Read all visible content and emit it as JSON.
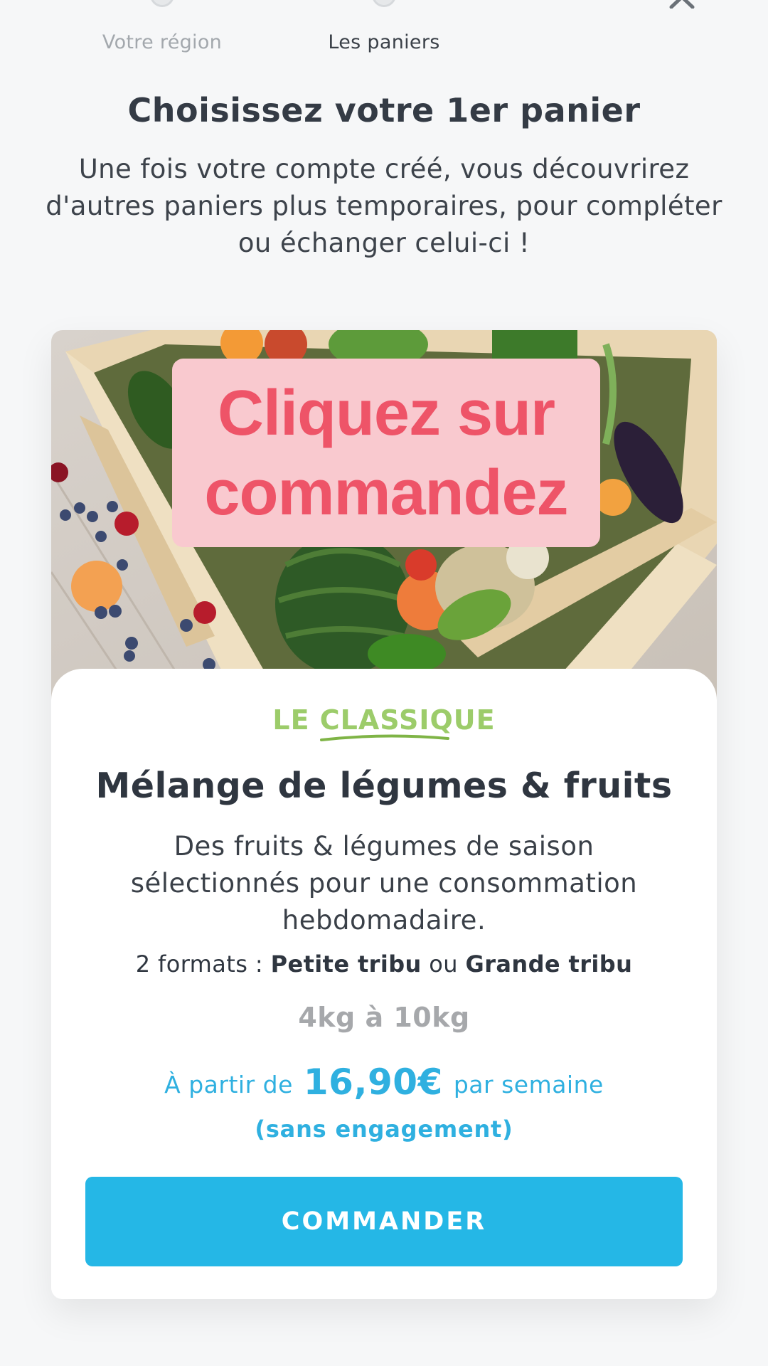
{
  "stepper": {
    "steps": [
      {
        "label": "Votre région",
        "state": "done"
      },
      {
        "label": "Les paniers",
        "state": "current"
      }
    ]
  },
  "page": {
    "title": "Choisissez votre 1er panier",
    "subtitle": "Une fois votre compte créé, vous découvrirez d'autres paniers plus temporaires, pour compléter ou échanger celui-ci !"
  },
  "card": {
    "overlay_text": "Cliquez sur commandez",
    "kicker": "LE CLASSIQUE",
    "title": "Mélange de légumes & fruits",
    "description": "Des fruits & légumes de saison sélectionnés pour une consommation hebdomadaire.",
    "formats": {
      "prefix": "2 formats : ",
      "option_1": "Petite tribu",
      "separator": " ou ",
      "option_2": "Grande tribu"
    },
    "weight_range": "4kg à 10kg",
    "price": {
      "prefix": "À partir de",
      "amount": "16,90€",
      "suffix": "par semaine",
      "note": "(sans engagement)"
    },
    "button_label": "COMMANDER"
  },
  "colors": {
    "accent_blue": "#25b7e6",
    "price_blue": "#2fb0e0",
    "kicker_green": "#9ccc6a",
    "overlay_pink_bg": "#f9c9cf",
    "overlay_pink_text": "#ee5468"
  },
  "icons": {
    "close": "close-icon"
  }
}
